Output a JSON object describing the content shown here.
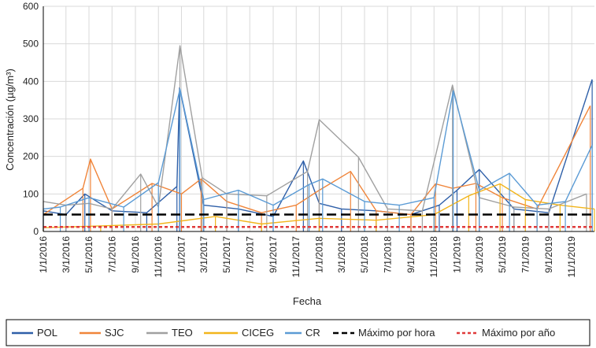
{
  "chart_data": {
    "type": "line",
    "xlabel": "Fecha",
    "ylabel": "Concentración (µg/m³)",
    "ylim": [
      0,
      600
    ],
    "yticks": [
      0,
      100,
      200,
      300,
      400,
      500,
      600
    ],
    "xlim": [
      "2016-01-01",
      "2019-12-31"
    ],
    "xticks": [
      "1/1/2016",
      "3/1/2016",
      "5/1/2016",
      "7/1/2016",
      "9/1/2016",
      "11/1/2016",
      "1/1/2017",
      "3/1/2017",
      "5/1/2017",
      "7/1/2017",
      "9/1/2017",
      "11/1/2017",
      "1/1/2018",
      "3/1/2018",
      "5/1/2018",
      "7/1/2018",
      "9/1/2018",
      "11/1/2018",
      "1/1/2019",
      "3/1/2019",
      "5/1/2019",
      "7/1/2019",
      "9/1/2019",
      "11/1/2019"
    ],
    "grid": true,
    "legend_position": "bottom",
    "series": [
      {
        "name": "POL",
        "color": "#2e5fa8",
        "style": "solid",
        "x": [
          "2016-01-01",
          "2016-03-01",
          "2016-04-20",
          "2016-07-01",
          "2016-10-01",
          "2016-12-20",
          "2016-12-27",
          "2017-03-01",
          "2017-06-01",
          "2017-09-01",
          "2017-11-20",
          "2018-01-01",
          "2018-03-01",
          "2018-06-01",
          "2018-09-01",
          "2018-11-15",
          "2019-01-01",
          "2019-03-01",
          "2019-06-01",
          "2019-09-01",
          "2019-12-25"
        ],
        "y": [
          55,
          45,
          100,
          55,
          50,
          120,
          383,
          70,
          60,
          40,
          188,
          75,
          60,
          55,
          45,
          70,
          110,
          165,
          60,
          50,
          405
        ]
      },
      {
        "name": "SJC",
        "color": "#f0853a",
        "style": "solid",
        "x": [
          "2016-01-01",
          "2016-04-15",
          "2016-05-05",
          "2016-07-01",
          "2016-10-15",
          "2017-01-01",
          "2017-02-22",
          "2017-05-01",
          "2017-08-01",
          "2017-11-01",
          "2018-01-01",
          "2018-03-25",
          "2018-06-01",
          "2018-09-01",
          "2018-11-05",
          "2018-12-20",
          "2019-02-20",
          "2019-05-01",
          "2019-08-01",
          "2019-12-20"
        ],
        "y": [
          45,
          115,
          193,
          60,
          128,
          100,
          140,
          80,
          50,
          70,
          110,
          160,
          55,
          45,
          127,
          115,
          128,
          90,
          60,
          335
        ]
      },
      {
        "name": "TEO",
        "color": "#a0a0a0",
        "style": "solid",
        "x": [
          "2016-01-01",
          "2016-03-01",
          "2016-05-01",
          "2016-07-01",
          "2016-09-15",
          "2016-11-01",
          "2016-12-28",
          "2017-02-25",
          "2017-05-01",
          "2017-08-15",
          "2017-12-01",
          "2018-01-01",
          "2018-04-15",
          "2018-07-01",
          "2018-10-01",
          "2018-12-20",
          "2019-03-01",
          "2019-06-01",
          "2019-09-01",
          "2019-12-10"
        ],
        "y": [
          80,
          70,
          75,
          60,
          153,
          65,
          495,
          143,
          100,
          95,
          160,
          298,
          198,
          60,
          55,
          390,
          90,
          65,
          60,
          100
        ]
      },
      {
        "name": "CICEG",
        "color": "#f2b51c",
        "style": "solid",
        "x": [
          "2016-01-01",
          "2016-06-01",
          "2016-11-01",
          "2017-04-01",
          "2017-08-01",
          "2018-01-01",
          "2018-06-01",
          "2018-11-01",
          "2019-02-01",
          "2019-04-25",
          "2019-07-01",
          "2019-10-01",
          "2019-12-31"
        ],
        "y": [
          10,
          15,
          20,
          40,
          20,
          35,
          30,
          45,
          95,
          127,
          85,
          70,
          60
        ]
      },
      {
        "name": "CR",
        "color": "#5b9bd5",
        "style": "solid",
        "x": [
          "2016-01-01",
          "2016-02-15",
          "2016-05-01",
          "2016-08-01",
          "2016-11-01",
          "2016-12-28",
          "2017-03-01",
          "2017-06-01",
          "2017-09-01",
          "2017-12-05",
          "2018-01-10",
          "2018-05-01",
          "2018-08-01",
          "2018-11-01",
          "2018-12-22",
          "2019-03-01",
          "2019-05-20",
          "2019-08-01",
          "2019-10-15",
          "2019-12-25"
        ],
        "y": [
          60,
          65,
          90,
          65,
          130,
          380,
          85,
          110,
          70,
          125,
          140,
          80,
          70,
          90,
          375,
          110,
          155,
          70,
          80,
          230
        ]
      },
      {
        "name": "Máximo por hora",
        "color": "#000000",
        "style": "dashed",
        "y": [
          45
        ]
      },
      {
        "name": "Máximo por año",
        "color": "#e03b3b",
        "style": "dotted",
        "y": [
          12
        ]
      }
    ]
  }
}
